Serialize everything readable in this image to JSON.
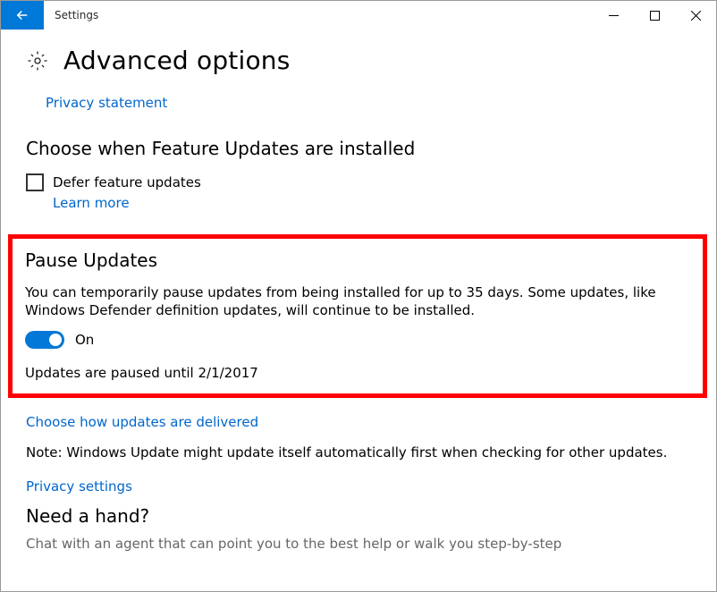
{
  "window": {
    "title": "Settings"
  },
  "page": {
    "title": "Advanced options"
  },
  "links": {
    "privacy_statement": "Privacy statement",
    "learn_more": "Learn more",
    "choose_delivery": "Choose how updates are delivered",
    "privacy_settings": "Privacy settings"
  },
  "feature_updates": {
    "heading": "Choose when Feature Updates are installed",
    "defer_label": "Defer feature updates"
  },
  "pause": {
    "heading": "Pause Updates",
    "description": "You can temporarily pause updates from being installed for up to 35 days. Some updates, like Windows Defender definition updates, will continue to be installed.",
    "toggle_label": "On",
    "status": "Updates are paused until 2/1/2017"
  },
  "note": "Note: Windows Update might update itself automatically first when checking for other updates.",
  "help": {
    "heading": "Need a hand?",
    "chat": "Chat with an agent that can point you to the best help or walk you step-by-step"
  }
}
